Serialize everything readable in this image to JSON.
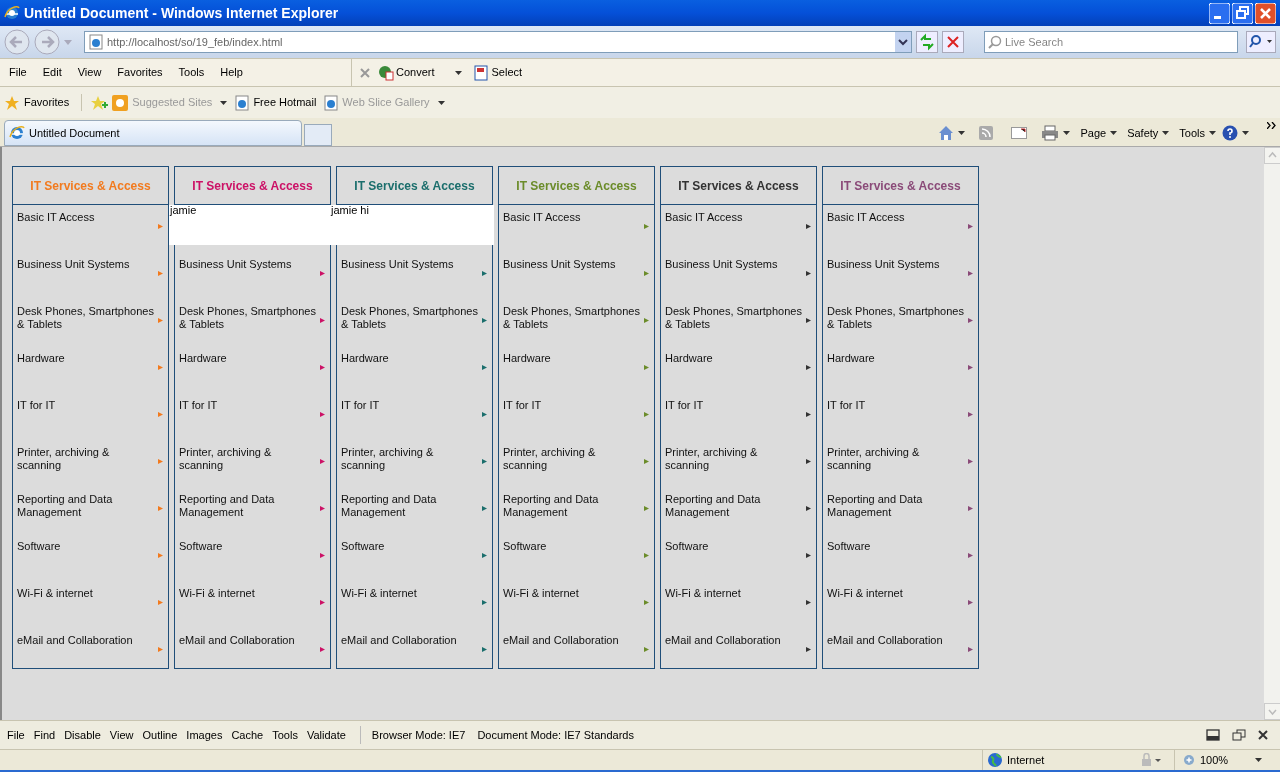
{
  "window": {
    "title": "Untitled Document - Windows Internet Explorer"
  },
  "address": {
    "url": "http://localhost/so/19_feb/index.html"
  },
  "search": {
    "placeholder": "Live Search"
  },
  "menu": [
    "File",
    "Edit",
    "View",
    "Favorites",
    "Tools",
    "Help"
  ],
  "addons": [
    {
      "label": "Convert",
      "dropdown": true
    },
    {
      "label": "Select",
      "dropdown": false
    }
  ],
  "favorites_bar": {
    "label": "Favorites",
    "links": [
      {
        "label": "Suggested Sites",
        "dimmed": true,
        "dropdown": true
      },
      {
        "label": "Free Hotmail",
        "dimmed": false,
        "dropdown": false
      },
      {
        "label": "Web Slice Gallery",
        "dimmed": true,
        "dropdown": true
      }
    ]
  },
  "tabs": [
    {
      "label": "Untitled Document",
      "selected": true
    }
  ],
  "command_bar": [
    "Page",
    "Safety",
    "Tools"
  ],
  "columns": [
    {
      "title": "IT Services & Access",
      "color": "#f27a1e",
      "items": [
        {
          "kind": "link",
          "label": "Basic IT Access"
        },
        {
          "kind": "link",
          "label": "Business Unit Systems"
        },
        {
          "kind": "link",
          "label": "Desk Phones, Smartphones & Tablets"
        },
        {
          "kind": "link",
          "label": "Hardware"
        },
        {
          "kind": "link",
          "label": "IT for IT"
        },
        {
          "kind": "link",
          "label": "Printer, archiving & scanning"
        },
        {
          "kind": "link",
          "label": "Reporting and Data Management"
        },
        {
          "kind": "link",
          "label": "Software"
        },
        {
          "kind": "link",
          "label": "Wi-Fi & internet"
        },
        {
          "kind": "link",
          "label": "eMail and Collaboration"
        }
      ]
    },
    {
      "title": "IT Services & Access",
      "color": "#cc1166",
      "items": [
        {
          "kind": "note",
          "label": "jamie"
        },
        {
          "kind": "link",
          "label": "Business Unit Systems"
        },
        {
          "kind": "link",
          "label": "Desk Phones, Smartphones & Tablets"
        },
        {
          "kind": "link",
          "label": "Hardware"
        },
        {
          "kind": "link",
          "label": "IT for IT"
        },
        {
          "kind": "link",
          "label": "Printer, archiving & scanning"
        },
        {
          "kind": "link",
          "label": "Reporting and Data Management"
        },
        {
          "kind": "link",
          "label": "Software"
        },
        {
          "kind": "link",
          "label": "Wi-Fi & internet"
        },
        {
          "kind": "link",
          "label": "eMail and Collaboration"
        }
      ]
    },
    {
      "title": "IT Services & Access",
      "color": "#1b6e6c",
      "items": [
        {
          "kind": "note",
          "label": "jamie hi"
        },
        {
          "kind": "link",
          "label": "Business Unit Systems"
        },
        {
          "kind": "link",
          "label": "Desk Phones, Smartphones & Tablets"
        },
        {
          "kind": "link",
          "label": "Hardware"
        },
        {
          "kind": "link",
          "label": "IT for IT"
        },
        {
          "kind": "link",
          "label": "Printer, archiving & scanning"
        },
        {
          "kind": "link",
          "label": "Reporting and Data Management"
        },
        {
          "kind": "link",
          "label": "Software"
        },
        {
          "kind": "link",
          "label": "Wi-Fi & internet"
        },
        {
          "kind": "link",
          "label": "eMail and Collaboration"
        }
      ]
    },
    {
      "title": "IT Services & Access",
      "color": "#6b8c2a",
      "items": [
        {
          "kind": "link",
          "label": "Basic IT Access"
        },
        {
          "kind": "link",
          "label": "Business Unit Systems"
        },
        {
          "kind": "link",
          "label": "Desk Phones, Smartphones & Tablets"
        },
        {
          "kind": "link",
          "label": "Hardware"
        },
        {
          "kind": "link",
          "label": "IT for IT"
        },
        {
          "kind": "link",
          "label": "Printer, archiving & scanning"
        },
        {
          "kind": "link",
          "label": "Reporting and Data Management"
        },
        {
          "kind": "link",
          "label": "Software"
        },
        {
          "kind": "link",
          "label": "Wi-Fi & internet"
        },
        {
          "kind": "link",
          "label": "eMail and Collaboration"
        }
      ]
    },
    {
      "title": "IT Services & Access",
      "color": "#333333",
      "items": [
        {
          "kind": "link",
          "label": "Basic IT Access"
        },
        {
          "kind": "link",
          "label": "Business Unit Systems"
        },
        {
          "kind": "link",
          "label": "Desk Phones, Smartphones & Tablets"
        },
        {
          "kind": "link",
          "label": "Hardware"
        },
        {
          "kind": "link",
          "label": "IT for IT"
        },
        {
          "kind": "link",
          "label": "Printer, archiving & scanning"
        },
        {
          "kind": "link",
          "label": "Reporting and Data Management"
        },
        {
          "kind": "link",
          "label": "Software"
        },
        {
          "kind": "link",
          "label": "Wi-Fi & internet"
        },
        {
          "kind": "link",
          "label": "eMail and Collaboration"
        }
      ]
    },
    {
      "title": "IT Services & Access",
      "color": "#8a4a78",
      "items": [
        {
          "kind": "link",
          "label": "Basic IT Access"
        },
        {
          "kind": "link",
          "label": "Business Unit Systems"
        },
        {
          "kind": "link",
          "label": "Desk Phones, Smartphones & Tablets"
        },
        {
          "kind": "link",
          "label": "Hardware"
        },
        {
          "kind": "link",
          "label": "IT for IT"
        },
        {
          "kind": "link",
          "label": "Printer, archiving & scanning"
        },
        {
          "kind": "link",
          "label": "Reporting and Data Management"
        },
        {
          "kind": "link",
          "label": "Software"
        },
        {
          "kind": "link",
          "label": "Wi-Fi & internet"
        },
        {
          "kind": "link",
          "label": "eMail and Collaboration"
        }
      ]
    }
  ],
  "developer_toolbar": {
    "menu": [
      "File",
      "Find",
      "Disable",
      "View",
      "Outline",
      "Images",
      "Cache",
      "Tools",
      "Validate"
    ],
    "modes": [
      "Browser Mode: IE7",
      "Document Mode: IE7 Standards"
    ]
  },
  "status_bar": {
    "zone": "Internet",
    "zoom": "100%"
  }
}
